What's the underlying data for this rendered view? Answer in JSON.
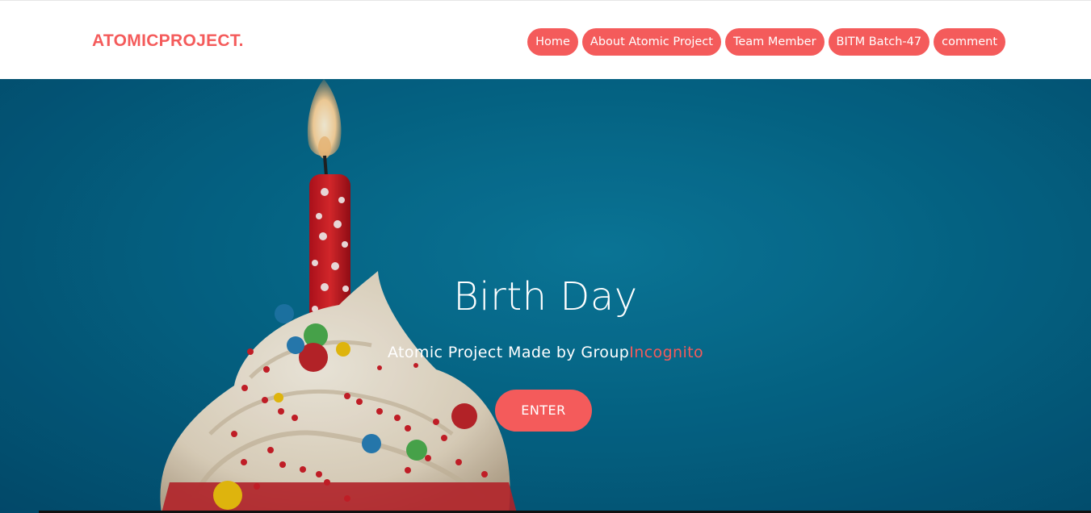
{
  "colors": {
    "accent": "#f45b5b",
    "hero_bg": "#056a8d",
    "text_light": "#ffffff"
  },
  "navbar": {
    "brand": "ATOMICPROJECT.",
    "links": [
      {
        "label": "Home"
      },
      {
        "label": "About Atomic Project"
      },
      {
        "label": "Team Member"
      },
      {
        "label": "BITM Batch-47"
      },
      {
        "label": "comment"
      }
    ]
  },
  "hero": {
    "title": "Birth Day",
    "subtitle_prefix": "Atomic Project Made by Group",
    "subtitle_highlight": "Incognito",
    "button_label": "ENTER",
    "background_image": "cupcake-with-candle-image"
  }
}
